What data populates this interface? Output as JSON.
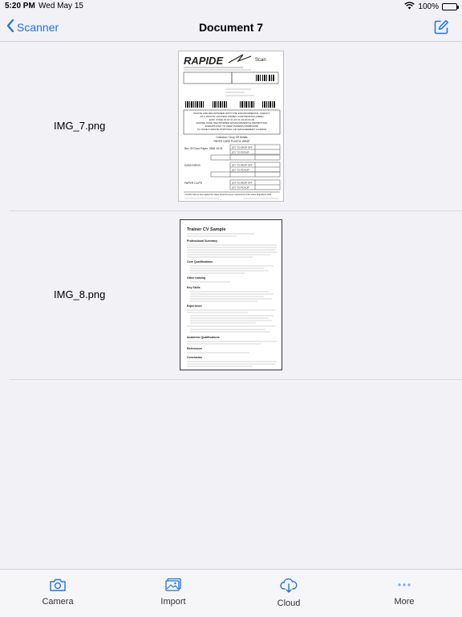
{
  "status": {
    "time": "5:20 PM",
    "date": "Wed May 15",
    "battery": "100%"
  },
  "nav": {
    "back_label": "Scanner",
    "title": "Document 7"
  },
  "files": [
    {
      "name": "IMG_7.png"
    },
    {
      "name": "IMG_8.png"
    }
  ],
  "thumb1": {
    "brand": "RAPIDE",
    "scan": "Scan",
    "line1": "WASTE ARE REGISTERED WITH THE ENVIRONMENTAL AGENCY",
    "line2": "AS A WASTE COURIER UNDER LICENSE/DISCLAIMER",
    "line3": "EWC CODE 15.01.01-16.01-02-03.01.06",
    "line4": "RAPIDE HAVE REGISTERED ENVIRONMENTAL PERMITTING",
    "line5": "EXEMPTIONS TO KEEP PAPER/CARDBOARD",
    "line6": "TO HAVE A WASTE DISPOSAL OR MANAGEMENT LICENCE",
    "collection": "Collection / Drop Off Details",
    "cols": "PAPER   CARD   PLASTIC   WRAP",
    "item1": "Box Of Docs Paper, 2846 15.01",
    "item2": "DATA DISCS",
    "item3": "PAPER CLIPS",
    "qty": "QTY TO DROP OFF",
    "pick": "QTY TO PICKUP",
    "foot": "I Confirm that we have applied the waste hierarchy as per requirements of the waste Regulations 2011"
  },
  "thumb2": {
    "title": "Trainer CV Sample",
    "h1": "Professional Summary",
    "h2": "Core Qualifications",
    "h3": "Other training",
    "h4": "Key Skills",
    "h5": "Experience",
    "h6": "Academic Qualifications",
    "h7": "References",
    "h8": "Conclusion"
  },
  "tabs": [
    {
      "label": "Camera",
      "icon": "camera-icon"
    },
    {
      "label": "Import",
      "icon": "photo-icon"
    },
    {
      "label": "Cloud",
      "icon": "cloud-download-icon"
    },
    {
      "label": "More",
      "icon": "more-icon"
    }
  ],
  "colors": {
    "accent": "#1a73e8",
    "background": "#f1f1f6"
  }
}
